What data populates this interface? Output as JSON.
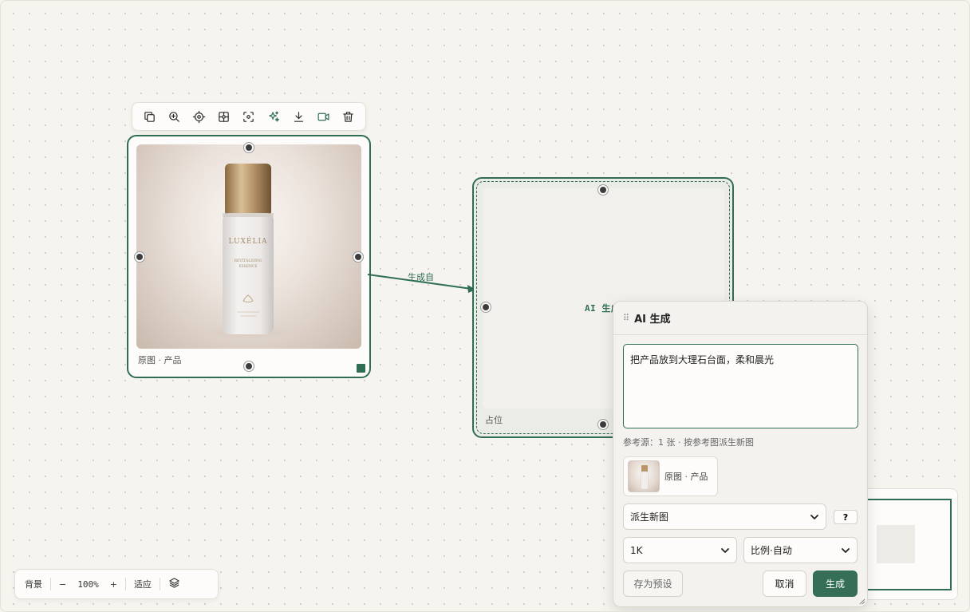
{
  "toolbar": {
    "icons": [
      "copy-icon",
      "zoom-in-icon",
      "target-icon",
      "frame-icon",
      "focus-icon",
      "sparkle-icon",
      "download-icon",
      "video-icon",
      "trash-icon"
    ]
  },
  "image_node": {
    "caption": "原图 · 产品",
    "bottle_brand": "LUXÉLIA",
    "bottle_line1": "REVITALISING",
    "bottle_line2": "ESSENCE"
  },
  "edge": {
    "label": "生成自"
  },
  "placeholder_node": {
    "center_text": "AI 生成草稿",
    "caption": "占位"
  },
  "ai_panel": {
    "title": "AI 生成",
    "prompt": "把产品放到大理石台面，柔和晨光",
    "reference_info": "参考源：1 张 · 按参考图派生新图",
    "reference_chip_label": "原图 · 产品",
    "mode_select": "派生新图",
    "help_label": "?",
    "resolution_select": "1K",
    "ratio_select": "比例·自动",
    "save_preset": "存为预设",
    "cancel": "取消",
    "generate": "生成"
  },
  "zoom_bar": {
    "background": "背景",
    "zoom_out": "−",
    "zoom_level": "100%",
    "zoom_in": "+",
    "fit": "适应"
  },
  "colors": {
    "accent": "#2f6e52",
    "canvas": "#f6f4ef"
  }
}
